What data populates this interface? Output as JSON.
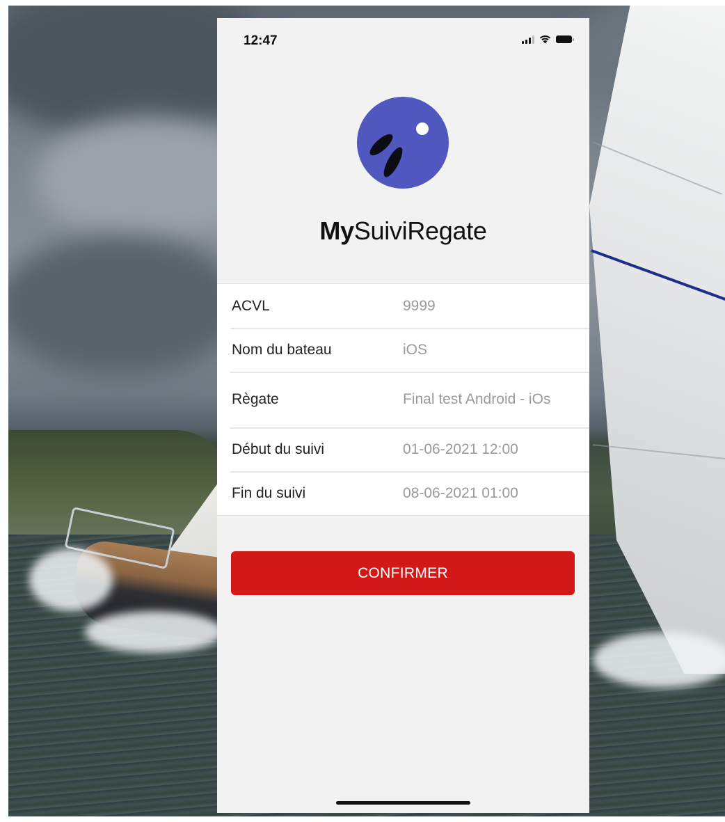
{
  "status_bar": {
    "time": "12:47",
    "icons": [
      "signal-icon",
      "wifi-icon",
      "battery-icon"
    ]
  },
  "app": {
    "title_bold": "My",
    "title_rest": "SuiviRegate",
    "logo_icon": "boats-logo-icon",
    "logo_color": "#5058c0"
  },
  "info": {
    "rows": [
      {
        "label": "ACVL",
        "value": "9999"
      },
      {
        "label": "Nom du bateau",
        "value": "iOS"
      },
      {
        "label": "Règate",
        "value": "Final test Android - iOs"
      },
      {
        "label": "Début du suivi",
        "value": "01-06-2021 12:00"
      },
      {
        "label": "Fin du suivi",
        "value": "08-06-2021 01:00"
      }
    ]
  },
  "actions": {
    "confirm_label": "CONFIRMER",
    "confirm_color": "#d31818"
  }
}
